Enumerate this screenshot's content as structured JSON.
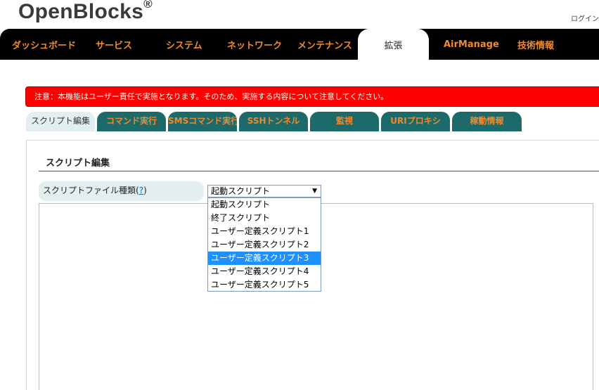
{
  "header": {
    "logo": "OpenBlocks",
    "logo_mark": "®",
    "login": "ログイン"
  },
  "nav": {
    "items": [
      {
        "label": "ダッシュボード",
        "active": false
      },
      {
        "label": "サービス",
        "active": false
      },
      {
        "label": "システム",
        "active": false
      },
      {
        "label": "ネットワーク",
        "active": false
      },
      {
        "label": "メンテナンス",
        "active": false
      },
      {
        "label": "拡張",
        "active": true
      },
      {
        "label": "AirManage",
        "active": false
      },
      {
        "label": "技術情報",
        "active": false
      }
    ]
  },
  "warning": {
    "text": "注意：本機能はユーザー責任で実施となります。そのため、実施する内容について注意してください。"
  },
  "tabs": {
    "items": [
      {
        "label": "スクリプト編集",
        "active": true
      },
      {
        "label": "コマンド実行",
        "active": false
      },
      {
        "label": "SMSコマンド実行",
        "active": false
      },
      {
        "label": "SSHトンネル",
        "active": false
      },
      {
        "label": "監視",
        "active": false
      },
      {
        "label": "URIプロキシ",
        "active": false
      },
      {
        "label": "稼動情報",
        "active": false
      }
    ]
  },
  "main": {
    "section_title": "スクリプト編集",
    "field_label": "スクリプトファイル種類",
    "help_open": "(",
    "help_mark": "?",
    "help_close": ")",
    "select_value": "起動スクリプト",
    "options": [
      {
        "label": "起動スクリプト",
        "selected": false
      },
      {
        "label": "終了スクリプト",
        "selected": false
      },
      {
        "label": "ユーザー定義スクリプト1",
        "selected": false
      },
      {
        "label": "ユーザー定義スクリプト2",
        "selected": false
      },
      {
        "label": "ユーザー定義スクリプト3",
        "selected": true
      },
      {
        "label": "ユーザー定義スクリプト4",
        "selected": false
      },
      {
        "label": "ユーザー定義スクリプト5",
        "selected": false
      }
    ]
  },
  "colors": {
    "nav_bg": "#000000",
    "nav_text": "#f08a2e",
    "tab_bg": "#1c6a6a",
    "tab_active_bg": "#e2eff0",
    "warning_bg": "#ff0000",
    "option_highlight": "#1e90ff"
  }
}
